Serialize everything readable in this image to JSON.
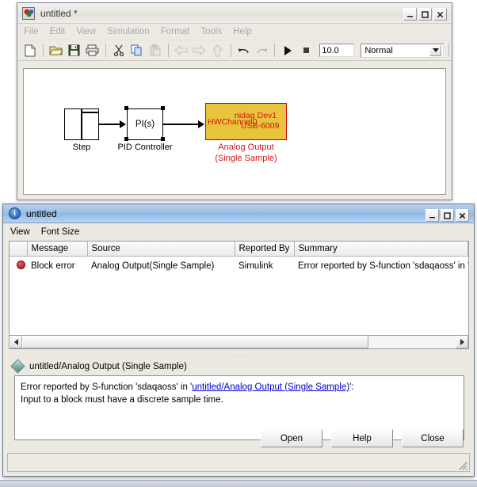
{
  "simulink_window": {
    "title": "untitled *",
    "app_icon": "simulink-icon",
    "window_buttons": {
      "minimize": "_",
      "maximize": "□",
      "close": "✕"
    },
    "menu": [
      "File",
      "Edit",
      "View",
      "Simulation",
      "Format",
      "Tools",
      "Help"
    ],
    "toolbar": {
      "icons": [
        "new-file-icon",
        "open-folder-icon",
        "save-icon",
        "print-icon",
        "cut-icon",
        "copy-icon",
        "paste-icon",
        "back-arrow-icon",
        "forward-arrow-icon",
        "up-arrow-icon",
        "undo-icon",
        "redo-icon",
        "start-simulation-icon",
        "stop-simulation-icon"
      ],
      "sim_time": "10.0",
      "sim_mode": "Normal"
    },
    "model": {
      "step_block_label": "Step",
      "pid_block_text": "PI(s)",
      "pid_block_label": "PID Controller",
      "analog_output": {
        "hwchannel": "HWChannel0",
        "device": "nidaq Dev1",
        "model": "USB-6009",
        "label_line1": "Analog Output",
        "label_line2": "(Single Sample)",
        "fill_color": "#e8c33c",
        "border_color": "#cc0000",
        "text_color": "#d41616"
      }
    }
  },
  "diagnostic_window": {
    "title": "untitled",
    "icon": "info-icon",
    "window_buttons": {
      "minimize": "_",
      "maximize": "□",
      "close": "✕"
    },
    "menu": [
      "View",
      "Font Size"
    ],
    "table": {
      "columns": [
        "",
        "Message",
        "Source",
        "Reported By",
        "Summary"
      ],
      "rows": [
        {
          "icon": "error-dot-icon",
          "message": "Block error",
          "source": "Analog Output(Single Sample)",
          "reported_by": "Simulink",
          "summary": "Error reported by S-function 'sdaqaoss' in 'untitl"
        }
      ]
    },
    "detail": {
      "header": "untitled/Analog Output (Single Sample)",
      "header_icon": "diamond-icon",
      "text_before_link": "Error reported by S-function 'sdaqaoss' in '",
      "link_text": "untitled/Analog Output (Single Sample)",
      "text_after_link": "':",
      "line2": "Input to a block must have a discrete sample time."
    },
    "buttons": [
      "Open",
      "Help",
      "Close"
    ],
    "splitter_dots": "·····"
  }
}
